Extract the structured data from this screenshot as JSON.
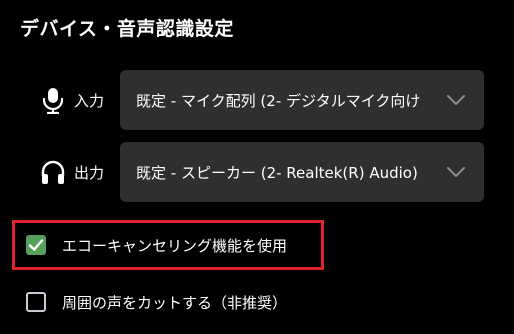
{
  "title": "デバイス・音声認識設定",
  "input": {
    "label": "入力",
    "icon": "microphone-icon",
    "selected": "既定 - マイク配列 (2- デジタルマイク向け"
  },
  "output": {
    "label": "出力",
    "icon": "headphones-icon",
    "selected": "既定 - スピーカー (2- Realtek(R) Audio)"
  },
  "options": {
    "echo_cancel": {
      "label": "エコーキャンセリング機能を使用",
      "checked": true
    },
    "noise_cut": {
      "label": "周囲の声をカットする（非推奨）",
      "checked": false
    }
  },
  "colors": {
    "background": "#000000",
    "select_bg": "#2f2f2f",
    "checkbox_checked": "#57a05c",
    "highlight": "#e0242c"
  }
}
